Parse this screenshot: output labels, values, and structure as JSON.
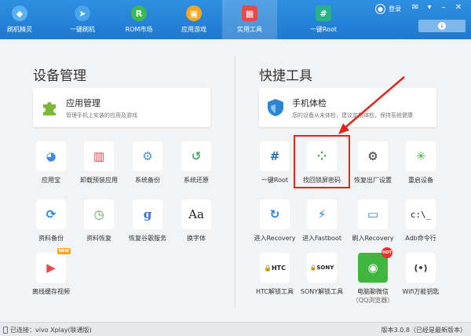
{
  "nav": [
    {
      "label": "刷机精灵",
      "icon": "shield-logo-icon",
      "color": "#5ab0f0"
    },
    {
      "label": "一键刷机",
      "icon": "cursor-icon",
      "color": "#49a4ea"
    },
    {
      "label": "ROM市场",
      "icon": "rom-r-icon",
      "color": "#3db855"
    },
    {
      "label": "应用游戏",
      "icon": "gamepad-icon",
      "color": "#f5a623"
    },
    {
      "label": "实用工具",
      "icon": "grid-tools-icon",
      "color": "#e8494b",
      "active": true
    },
    {
      "label": "一键Root",
      "icon": "android-root-icon",
      "color": "#27b38a"
    }
  ],
  "login": {
    "label": "登录"
  },
  "device_section": {
    "title": "设备管理",
    "card": {
      "title": "应用管理",
      "subtitle": "管理手机上安装的应用及游戏"
    },
    "tools": [
      {
        "label": "应用宝",
        "icon": "yingyongbao-icon",
        "color": "#ffffff",
        "glyph": "◕"
      },
      {
        "label": "卸载预装应用",
        "icon": "trash-icon",
        "color": "#e04646",
        "glyph": "🗑"
      },
      {
        "label": "系统备份",
        "icon": "system-backup-icon",
        "color": "#4f8dd6",
        "glyph": "⚙"
      },
      {
        "label": "系统还原",
        "icon": "system-restore-icon",
        "color": "#4aa86a",
        "glyph": "↺"
      },
      {
        "label": "资料备份",
        "icon": "sync-icon",
        "color": "#ffffff",
        "glyph": "⟳"
      },
      {
        "label": "资料恢复",
        "icon": "clock-restore-icon",
        "color": "#ffffff",
        "glyph": "◷"
      },
      {
        "label": "恢复谷歌服务",
        "icon": "google-icon",
        "color": "#ffffff",
        "glyph": "g"
      },
      {
        "label": "换字体",
        "icon": "font-icon",
        "color": "#ffffff",
        "glyph": "Aa"
      },
      {
        "label": "离线缓存视频",
        "icon": "video-cache-icon",
        "color": "#e8494b",
        "glyph": "▶",
        "badge": "NEW"
      }
    ]
  },
  "quick_section": {
    "title": "快捷工具",
    "card": {
      "title": "手机体检",
      "subtitle": "您的设备从未体检，建议定期体检，保持系统健康"
    },
    "tools": [
      {
        "label": "一键Root",
        "icon": "android-root-icon",
        "color": "#2e6ea6",
        "glyph": "#"
      },
      {
        "label": "找回锁屏密码",
        "icon": "pattern-lock-icon",
        "color": "#ffffff",
        "glyph": "⁘"
      },
      {
        "label": "恢复出厂设置",
        "icon": "gears-icon",
        "color": "#ffffff",
        "glyph": "⚙"
      },
      {
        "label": "重启设备",
        "icon": "loading-icon",
        "color": "#ffffff",
        "glyph": "✳"
      },
      {
        "label": "进入Recovery",
        "icon": "refresh-icon",
        "color": "#ffffff",
        "glyph": "↻"
      },
      {
        "label": "进入Fastboot",
        "icon": "lightning-icon",
        "color": "#ffffff",
        "glyph": "⚡"
      },
      {
        "label": "刷入Recovery",
        "icon": "phone-edit-icon",
        "color": "#ffffff",
        "glyph": "▭"
      },
      {
        "label": "Adb命令行",
        "icon": "terminal-icon",
        "color": "#ffffff",
        "glyph": "c:\\_"
      },
      {
        "label": "HTC解锁工具",
        "icon": "htc-lock-icon",
        "color": "#ffffff",
        "glyph": "HTC"
      },
      {
        "label": "SONY解锁工具",
        "icon": "sony-lock-icon",
        "color": "#ffffff",
        "glyph": "SONY"
      },
      {
        "label": "电脑聊微信",
        "sublabel": "（QQ浏览器）",
        "icon": "wechat-icon",
        "color": "#3fb63f",
        "glyph": "◉",
        "badge": "HOT"
      },
      {
        "label": "Wifi万能钥匙",
        "icon": "wifi-key-icon",
        "color": "#ffffff",
        "glyph": "(•)"
      }
    ]
  },
  "status": {
    "connected": "已连接：vivo Xplay(联通版)",
    "version": "版本3.0.8（已经是最新版本）"
  },
  "colors": {
    "topbar": "#2583d8",
    "highlight": "#e0251b",
    "arrow": "#e0251b"
  }
}
